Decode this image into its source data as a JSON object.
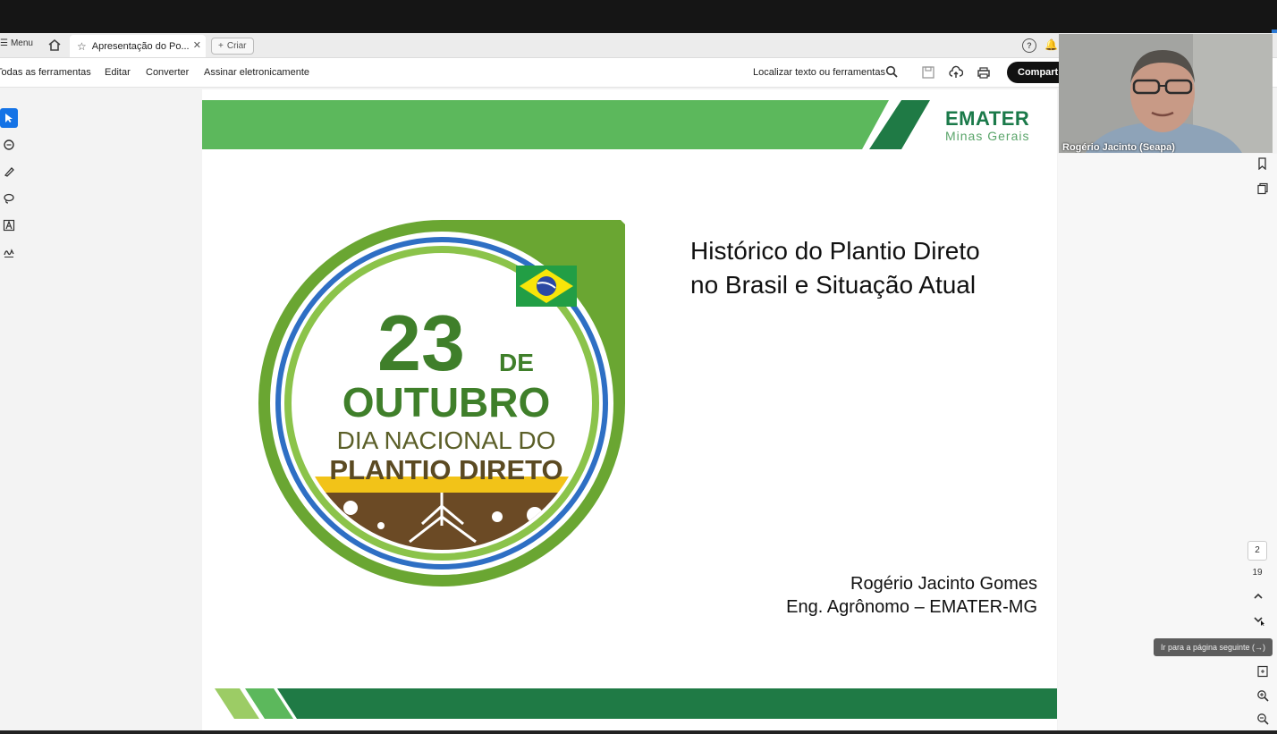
{
  "tabbar": {
    "menu_label": "Menu",
    "tab_title": "Apresentação do Po...",
    "create_label": "Criar"
  },
  "toolbar": {
    "all_tools": "Todas as ferramentas",
    "edit": "Editar",
    "convert": "Converter",
    "sign": "Assinar eletronicamente",
    "find_placeholder": "Localizar texto ou ferramentas",
    "share_label": "Compart"
  },
  "slide": {
    "title_line1": "Histórico do Plantio Direto",
    "title_line2": "no Brasil e Situação Atual",
    "author_name": "Rogério Jacinto Gomes",
    "author_role": "Eng. Agrônomo – EMATER-MG",
    "logo_main": "EMATER",
    "logo_sub": "Minas Gerais",
    "badge": {
      "day": "23",
      "de": "DE",
      "month": "OUTUBRO",
      "line1": "DIA NACIONAL DO",
      "line2": "PLANTIO DIRETO"
    }
  },
  "pager": {
    "current_page": "2",
    "total_pages": "19",
    "tooltip": "Ir para a página seguinte (→)"
  },
  "webcam": {
    "participant_name": "Rogério Jacinto (Seapa)"
  },
  "colors": {
    "accent_blue": "#1473e6",
    "emater_green": "#1b7a4a",
    "light_green": "#5cb85c",
    "dark_green": "#1f7a45"
  }
}
